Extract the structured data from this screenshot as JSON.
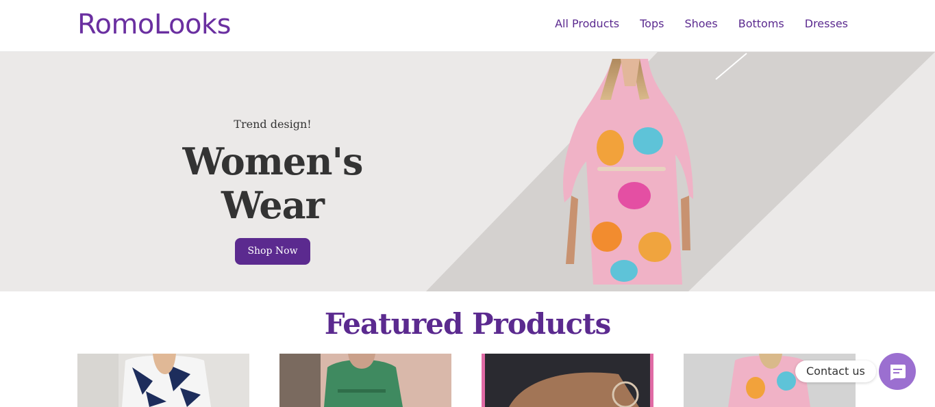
{
  "header": {
    "logo": "RomoLooks",
    "nav": [
      "All Products",
      "Tops",
      "Shoes",
      "Bottoms",
      "Dresses"
    ]
  },
  "hero": {
    "eyebrow": "Trend design!",
    "title": "Women's Wear",
    "cta": "Shop Now"
  },
  "featured": {
    "title": "Featured Products"
  },
  "contact": {
    "label": "Contact us",
    "icon": "chat-icon"
  },
  "colors": {
    "brand": "#6a2fa0",
    "cta_bg": "#5b2a8f",
    "hero_bg": "#ebe9e8",
    "contact_btn": "#9b6fd0"
  }
}
